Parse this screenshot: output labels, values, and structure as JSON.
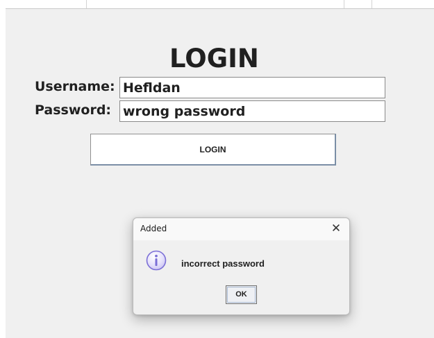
{
  "login_window": {
    "title": "LOGIN",
    "username_label": "Username:",
    "username_value": "Hefldan",
    "password_label": "Password:",
    "password_value": "wrong password",
    "login_button_label": "LOGIN"
  },
  "dialog": {
    "title": "Added",
    "close_glyph": "✕",
    "icon": "information-icon",
    "message": "incorrect password",
    "ok_label": "OK"
  },
  "colors": {
    "frame_background": "#f0f0f0",
    "icon_accent": "#7b6fd6"
  }
}
